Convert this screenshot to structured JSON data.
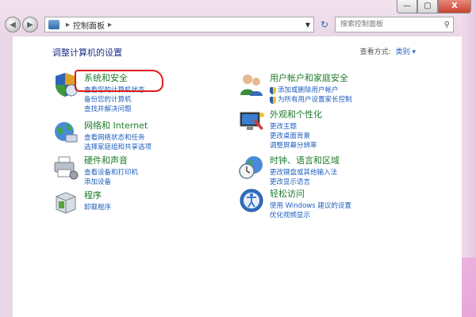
{
  "window": {
    "address": "控制面板",
    "search_placeholder": "搜索控制面板",
    "min_label": "—",
    "max_label": "▢",
    "close_label": "X"
  },
  "header": {
    "title": "调整计算机的设置",
    "view_by_label": "查看方式:",
    "view_by_value": "类别 ▾"
  },
  "categories": [
    {
      "title": "系统和安全",
      "links": [
        "查看您的计算机状态",
        "备份您的计算机",
        "查找并解决问题"
      ]
    },
    {
      "title": "网络和 Internet",
      "links": [
        "查看网络状态和任务",
        "选择家庭组和共享选项"
      ]
    },
    {
      "title": "硬件和声音",
      "links": [
        "查看设备和打印机",
        "添加设备"
      ]
    },
    {
      "title": "程序",
      "links": [
        "卸载程序"
      ]
    },
    {
      "title": "用户帐户和家庭安全",
      "links": [
        "添加或删除用户帐户",
        "为所有用户设置家长控制"
      ]
    },
    {
      "title": "外观和个性化",
      "links": [
        "更改主题",
        "更改桌面背景",
        "调整屏幕分辨率"
      ]
    },
    {
      "title": "时钟、语言和区域",
      "links": [
        "更改键盘或其他输入法",
        "更改显示语言"
      ]
    },
    {
      "title": "轻松访问",
      "links": [
        "使用 Windows 建议的设置",
        "优化视频显示"
      ]
    }
  ],
  "colors": {
    "title_blue": "#1e3287",
    "category_green": "#1d7a2a",
    "link_blue": "#1e5fbf",
    "annotation_red": "#e01b1b"
  }
}
